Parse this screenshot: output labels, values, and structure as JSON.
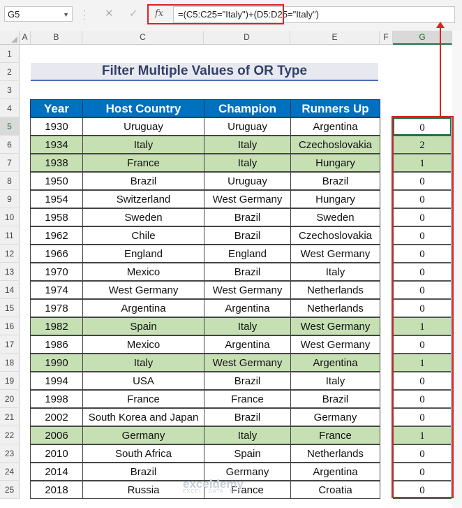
{
  "name_box": "G5",
  "formula_bar": {
    "cancel_symbol": "✕",
    "enter_symbol": "✓",
    "fx_symbol": "fx",
    "formula": "=(C5:C25=\"Italy\")+(D5:D25=\"Italy\")"
  },
  "columns": [
    "A",
    "B",
    "C",
    "D",
    "E",
    "F",
    "G"
  ],
  "rows": [
    "1",
    "2",
    "3",
    "4",
    "5",
    "6",
    "7",
    "8",
    "9",
    "10",
    "11",
    "12",
    "13",
    "14",
    "15",
    "16",
    "17",
    "18",
    "19",
    "20",
    "21",
    "22",
    "23",
    "24",
    "25"
  ],
  "title": "Filter Multiple Values of OR Type",
  "headers": [
    "Year",
    "Host Country",
    "Champion",
    "Runners Up"
  ],
  "data_rows": [
    {
      "year": "1930",
      "host": "Uruguay",
      "champion": "Uruguay",
      "runner": "Argentina",
      "g": "0",
      "hl": false
    },
    {
      "year": "1934",
      "host": "Italy",
      "champion": "Italy",
      "runner": "Czechoslovakia",
      "g": "2",
      "hl": true
    },
    {
      "year": "1938",
      "host": "France",
      "champion": "Italy",
      "runner": "Hungary",
      "g": "1",
      "hl": true
    },
    {
      "year": "1950",
      "host": "Brazil",
      "champion": "Uruguay",
      "runner": "Brazil",
      "g": "0",
      "hl": false
    },
    {
      "year": "1954",
      "host": "Switzerland",
      "champion": "West Germany",
      "runner": "Hungary",
      "g": "0",
      "hl": false
    },
    {
      "year": "1958",
      "host": "Sweden",
      "champion": "Brazil",
      "runner": "Sweden",
      "g": "0",
      "hl": false
    },
    {
      "year": "1962",
      "host": "Chile",
      "champion": "Brazil",
      "runner": "Czechoslovakia",
      "g": "0",
      "hl": false
    },
    {
      "year": "1966",
      "host": "England",
      "champion": "England",
      "runner": "West Germany",
      "g": "0",
      "hl": false
    },
    {
      "year": "1970",
      "host": "Mexico",
      "champion": "Brazil",
      "runner": "Italy",
      "g": "0",
      "hl": false
    },
    {
      "year": "1974",
      "host": "West Germany",
      "champion": "West Germany",
      "runner": "Netherlands",
      "g": "0",
      "hl": false
    },
    {
      "year": "1978",
      "host": "Argentina",
      "champion": "Argentina",
      "runner": "Netherlands",
      "g": "0",
      "hl": false
    },
    {
      "year": "1982",
      "host": "Spain",
      "champion": "Italy",
      "runner": "West Germany",
      "g": "1",
      "hl": true
    },
    {
      "year": "1986",
      "host": "Mexico",
      "champion": "Argentina",
      "runner": "West Germany",
      "g": "0",
      "hl": false
    },
    {
      "year": "1990",
      "host": "Italy",
      "champion": "West Germany",
      "runner": "Argentina",
      "g": "1",
      "hl": true
    },
    {
      "year": "1994",
      "host": "USA",
      "champion": "Brazil",
      "runner": "Italy",
      "g": "0",
      "hl": false
    },
    {
      "year": "1998",
      "host": "France",
      "champion": "France",
      "runner": "Brazil",
      "g": "0",
      "hl": false
    },
    {
      "year": "2002",
      "host": "South Korea and Japan",
      "champion": "Brazil",
      "runner": "Germany",
      "g": "0",
      "hl": false
    },
    {
      "year": "2006",
      "host": "Germany",
      "champion": "Italy",
      "runner": "France",
      "g": "1",
      "hl": true
    },
    {
      "year": "2010",
      "host": "South Africa",
      "champion": "Spain",
      "runner": "Netherlands",
      "g": "0",
      "hl": false
    },
    {
      "year": "2014",
      "host": "Brazil",
      "champion": "Germany",
      "runner": "Argentina",
      "g": "0",
      "hl": false
    },
    {
      "year": "2018",
      "host": "Russia",
      "champion": "France",
      "runner": "Croatia",
      "g": "0",
      "hl": false
    }
  ],
  "watermark": {
    "name": "exceldemy",
    "tagline": "EXCEL · DATA · BI"
  }
}
